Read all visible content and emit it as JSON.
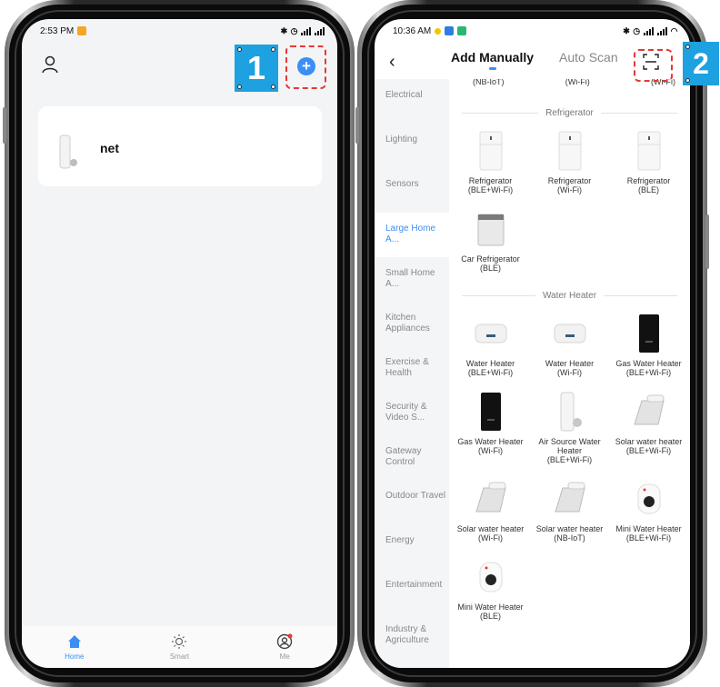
{
  "left_phone": {
    "status": {
      "time": "2:53 PM",
      "right_text": "4G 4G"
    },
    "device_card": {
      "name": "net"
    },
    "step_badge": "1",
    "tabbar": [
      {
        "label": "Home",
        "active": true
      },
      {
        "label": "Smart",
        "active": false
      },
      {
        "label": "Me",
        "active": false
      }
    ]
  },
  "right_phone": {
    "status": {
      "time": "10:36 AM"
    },
    "nav": {
      "tabs": [
        "Add Manually",
        "Auto Scan"
      ]
    },
    "step_badge": "2",
    "categories": [
      "Electrical",
      "Lighting",
      "Sensors",
      "Large Home A...",
      "Small Home A...",
      "Kitchen Appliances",
      "Exercise & Health",
      "Security & Video S...",
      "Gateway Control",
      "Outdoor Travel",
      "Energy",
      "Entertainment",
      "Industry & Agriculture"
    ],
    "active_category_index": 3,
    "top_row": [
      "(NB-IoT)",
      "(Wi-Fi)",
      "(Wi-Fi)"
    ],
    "sections": [
      {
        "title": "Refrigerator",
        "items": [
          {
            "name": "Refrigerator",
            "sub": "(BLE+Wi-Fi)",
            "icon": "fridge-icon"
          },
          {
            "name": "Refrigerator",
            "sub": "(Wi-Fi)",
            "icon": "fridge-icon"
          },
          {
            "name": "Refrigerator",
            "sub": "(BLE)",
            "icon": "fridge-icon"
          },
          {
            "name": "Car Refrigerator",
            "sub": "(BLE)",
            "icon": "car-fridge-icon"
          }
        ]
      },
      {
        "title": "Water Heater",
        "items": [
          {
            "name": "Water Heater",
            "sub": "(BLE+Wi-Fi)",
            "icon": "water-heater-icon"
          },
          {
            "name": "Water Heater",
            "sub": "(Wi-Fi)",
            "icon": "water-heater-icon"
          },
          {
            "name": "Gas Water Heater",
            "sub": "(BLE+Wi-Fi)",
            "icon": "gas-heater-icon"
          },
          {
            "name": "Gas Water Heater",
            "sub": "(Wi-Fi)",
            "icon": "gas-heater-icon"
          },
          {
            "name": "Air Source Water Heater",
            "sub": "(BLE+Wi-Fi)",
            "icon": "air-source-heater-icon"
          },
          {
            "name": "Solar water heater",
            "sub": "(BLE+Wi-Fi)",
            "icon": "solar-heater-icon"
          },
          {
            "name": "Solar water heater",
            "sub": "(Wi-Fi)",
            "icon": "solar-heater-icon"
          },
          {
            "name": "Solar water heater",
            "sub": "(NB-IoT)",
            "icon": "solar-heater-icon"
          },
          {
            "name": "Mini Water Heater",
            "sub": "(BLE+Wi-Fi)",
            "icon": "mini-heater-icon"
          },
          {
            "name": "Mini Water Heater",
            "sub": "(BLE)",
            "icon": "mini-heater-icon"
          }
        ]
      }
    ]
  }
}
